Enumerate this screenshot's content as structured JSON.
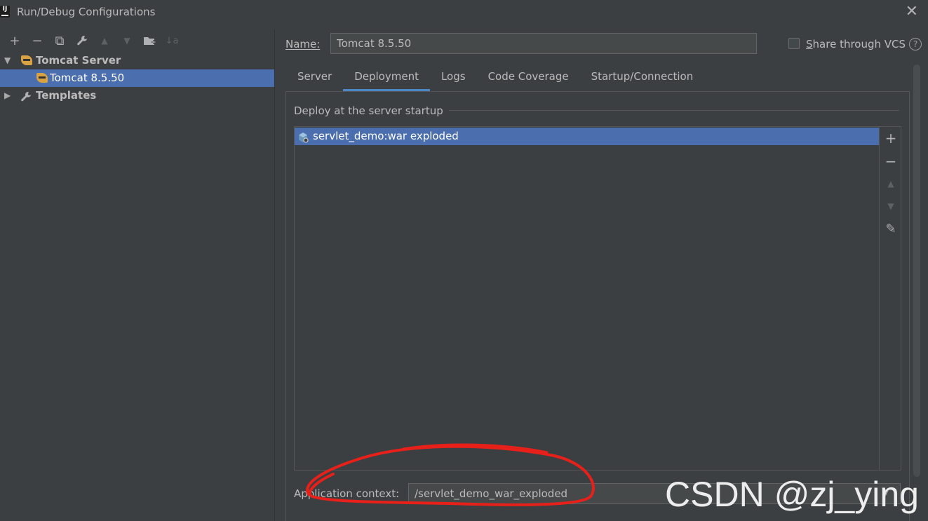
{
  "window": {
    "title": "Run/Debug Configurations",
    "app_icon_text": "IJ",
    "close_glyph": "✕"
  },
  "toolbar": {
    "add": "+",
    "remove": "−",
    "copy": "⧉",
    "edit_templates": "wrench-icon",
    "move_up": "▲",
    "move_down": "▼",
    "new_folder": "folder-add-icon",
    "sort": "↓a"
  },
  "tree": {
    "group_label": "Tomcat Server",
    "group_expanded_glyph": "▼",
    "item_label": "Tomcat 8.5.50",
    "templates_label": "Templates",
    "templates_collapsed_glyph": "▶"
  },
  "form": {
    "name_label": "Name:",
    "name_value": "Tomcat 8.5.50",
    "share_label_underlined": "S",
    "share_label_rest": "hare through VCS",
    "share_checked": false,
    "help_glyph": "?"
  },
  "tabs": [
    "Server",
    "Deployment",
    "Logs",
    "Code Coverage",
    "Startup/Connection"
  ],
  "active_tab": "Deployment",
  "deployment": {
    "section_title": "Deploy at the server startup",
    "items": [
      "servlet_demo:war exploded"
    ],
    "list_buttons": {
      "add": "+",
      "remove": "−",
      "up": "▲",
      "down": "▼",
      "edit": "✎"
    },
    "context_label": "Application context:",
    "context_value": "/servlet_demo_war_exploded",
    "context_dropdown": "▼"
  },
  "watermark": "CSDN @zj_ying",
  "colors": {
    "background": "#3c3f41",
    "selection": "#4b6eaf",
    "tab_underline": "#4a88c7",
    "annotation": "#e8201a"
  }
}
